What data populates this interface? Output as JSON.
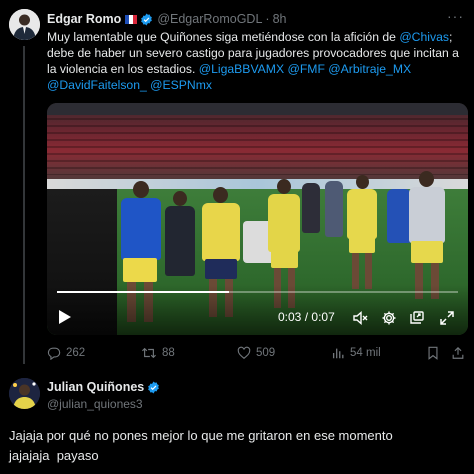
{
  "tweet1": {
    "author_name": "Edgar Romo",
    "flag_icon": "france-flag-icon",
    "handle": "@EdgarRomoGDL",
    "separator": "·",
    "time": "8h",
    "more_icon": "···",
    "text_parts": {
      "p1": "Muy lamentable que Quiñones siga metiéndose con la afición de ",
      "m1": "@Chivas",
      "p2": "; debe de haber un severo castigo para jugadores provocadores que incitan a la violencia en los estadios. ",
      "m2": "@LigaBBVAMX",
      "m3": "@FMF",
      "m4": "@Arbitraje_MX",
      "m5": "@DavidFaitelson_",
      "m6": "@ESPNmx"
    },
    "video": {
      "current_time": "0:03",
      "time_sep": "/",
      "duration": "0:07",
      "progress": 0.43
    },
    "actions": {
      "replies": "262",
      "retweets": "88",
      "likes": "509",
      "views": "54 mil"
    }
  },
  "tweet2": {
    "author_name": "Julian Quiñones",
    "handle": "@julian_quiones3",
    "text_line1": "Jajaja por qué no pones mejor lo que me gritaron en ese momento",
    "text_line2": "jajajaja  payaso"
  },
  "colors": {
    "background": "#000000",
    "text": "#e7e9ea",
    "muted": "#71767b",
    "link": "#1d9bf0",
    "verified": "#1d9bf0"
  }
}
